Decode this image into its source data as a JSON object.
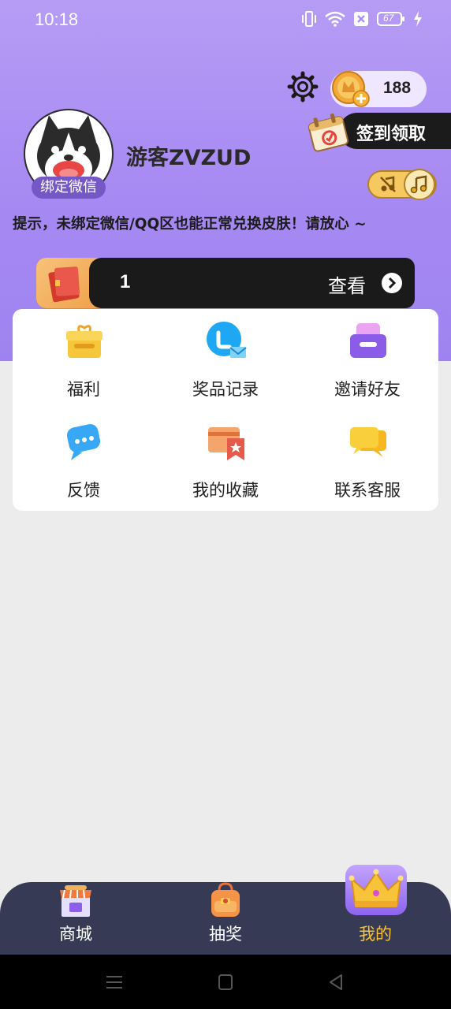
{
  "status_bar": {
    "time": "10:18",
    "battery": "67",
    "icons": [
      "vibrate-icon",
      "wifi-icon",
      "sim-off-icon",
      "battery-icon",
      "charging-icon"
    ]
  },
  "header": {
    "coins": "188",
    "signin_label": "签到领取",
    "username": "游客ZVZUD",
    "bind_label": "绑定微信",
    "tip": "提示，未绑定微信/QQ区也能正常兑换皮肤！请放心 ~"
  },
  "skin_bar": {
    "count": "1",
    "view_label": "查看"
  },
  "menu": {
    "items": [
      {
        "label": "福利",
        "icon": "gift-box-icon"
      },
      {
        "label": "奖品记录",
        "icon": "record-icon"
      },
      {
        "label": "邀请好友",
        "icon": "invite-icon"
      },
      {
        "label": "反馈",
        "icon": "feedback-icon"
      },
      {
        "label": "我的收藏",
        "icon": "favorites-icon"
      },
      {
        "label": "联系客服",
        "icon": "customer-service-icon"
      }
    ]
  },
  "bottom_nav": {
    "items": [
      {
        "label": "商城",
        "icon": "store-icon"
      },
      {
        "label": "抽奖",
        "icon": "lottery-bag-icon"
      },
      {
        "label": "我的",
        "icon": "crown-icon"
      }
    ],
    "active": 2
  },
  "colors": {
    "header_purple": "#a789f3",
    "active_nav": "#f7c338",
    "nav_bg": "#363a55"
  }
}
